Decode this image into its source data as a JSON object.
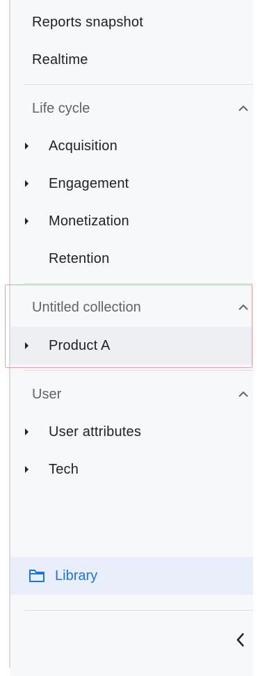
{
  "nav": {
    "top_items": [
      {
        "label": "Reports snapshot"
      },
      {
        "label": "Realtime"
      }
    ],
    "sections": [
      {
        "title": "Life cycle",
        "items": [
          {
            "label": "Acquisition",
            "expandable": true
          },
          {
            "label": "Engagement",
            "expandable": true
          },
          {
            "label": "Monetization",
            "expandable": true
          },
          {
            "label": "Retention",
            "expandable": false
          }
        ]
      },
      {
        "title": "Untitled collection",
        "items": [
          {
            "label": "Product A",
            "expandable": true
          }
        ]
      },
      {
        "title": "User",
        "items": [
          {
            "label": "User attributes",
            "expandable": true
          },
          {
            "label": "Tech",
            "expandable": true
          }
        ]
      }
    ],
    "library": {
      "label": "Library",
      "icon": "folder-icon"
    },
    "collapse_icon": "chevron-left-icon"
  },
  "colors": {
    "accent": "#1a73e8",
    "panel_bg": "#f7f8fa",
    "library_bg": "#e8effb",
    "highlight_border": "#e8a0a0"
  }
}
